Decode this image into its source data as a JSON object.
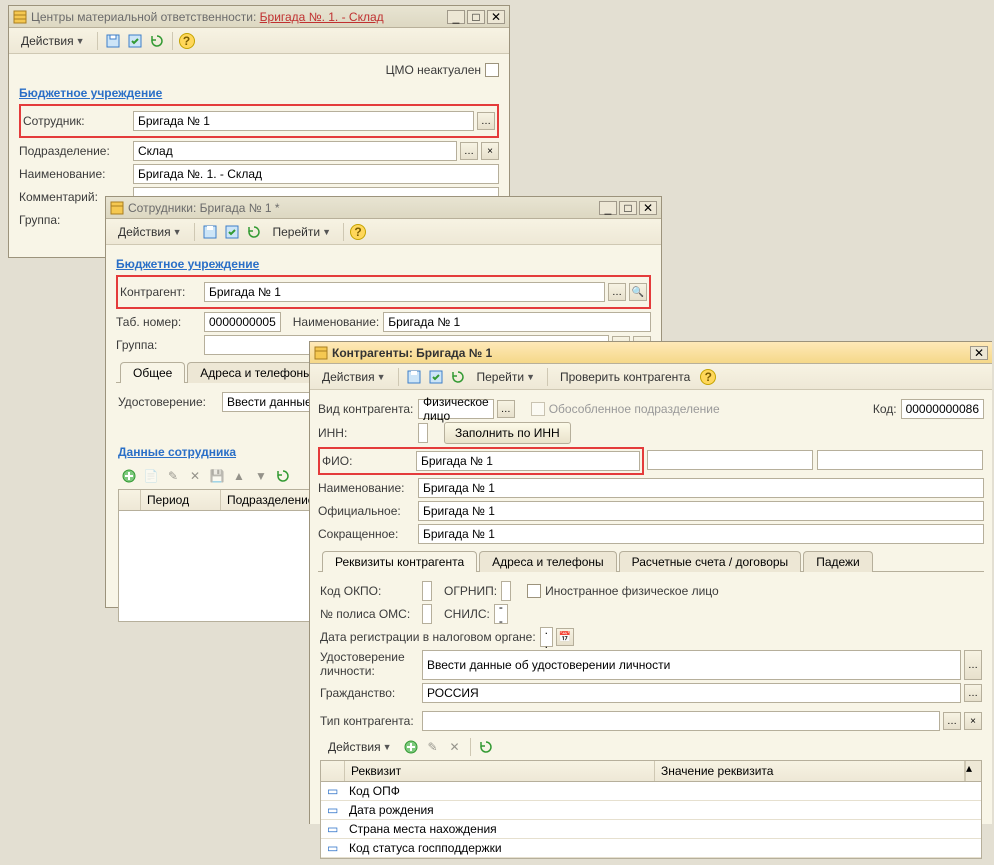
{
  "toolbar": {
    "actions": "Действия",
    "goto": "Перейти",
    "check": "Проверить контрагента"
  },
  "win1": {
    "title_prefix": "Центры материальной ответственности: ",
    "title_red": "Бригада №. 1. - Склад",
    "not_actual": "ЦМО неактуален",
    "section": "Бюджетное учреждение",
    "fields": {
      "employee_label": "Сотрудник:",
      "employee_value": "Бригада № 1",
      "dept_label": "Подразделение:",
      "dept_value": "Склад",
      "name_label": "Наименование:",
      "name_value": "Бригада №. 1. - Склад",
      "comment_label": "Комментарий:",
      "comment_value": "",
      "group_label": "Группа:",
      "group_value": ""
    }
  },
  "win2": {
    "title": "Сотрудники: Бригада № 1 *",
    "section": "Бюджетное учреждение",
    "fields": {
      "counterparty_label": "Контрагент:",
      "counterparty_value": "Бригада № 1",
      "tabnum_label": "Таб. номер:",
      "tabnum_value": "0000000005",
      "name_label": "Наименование:",
      "name_value": "Бригада № 1",
      "group_label": "Группа:",
      "group_value": ""
    },
    "tabs": {
      "general": "Общее",
      "addresses": "Адреса и телефоны"
    },
    "identity_label": "Удостоверение:",
    "identity_value": "Ввести данные об",
    "section2": "Данные сотрудника",
    "table_headers": [
      "Период",
      "Подразделение"
    ]
  },
  "win3": {
    "title": "Контрагенты: Бригада № 1",
    "fields": {
      "kind_label": "Вид контрагента:",
      "kind_value": "Физическое лицо",
      "detached_label": "Обособленное подразделение",
      "code_label": "Код:",
      "code_value": "00000000086",
      "inn_label": "ИНН:",
      "inn_value": "",
      "fill_inn": "Заполнить по ИНН",
      "fio_label": "ФИО:",
      "fio_value": "Бригада № 1",
      "name_label": "Наименование:",
      "name_value": "Бригада № 1",
      "official_label": "Официальное:",
      "official_value": "Бригада № 1",
      "short_label": "Сокращенное:",
      "short_value": "Бригада № 1"
    },
    "tabs": {
      "req": "Реквизиты контрагента",
      "addr": "Адреса и телефоны",
      "acc": "Расчетные счета / договоры",
      "cases": "Падежи"
    },
    "details": {
      "okpo_label": "Код ОКПО:",
      "okpo_value": "",
      "ogrnip_label": "ОГРНИП:",
      "ogrnip_value": "",
      "foreign_label": "Иностранное физическое лицо",
      "oms_label": "№ полиса ОМС:",
      "oms_value": "",
      "snils_label": "СНИЛС:",
      "snils_value": "  -   -",
      "regdate_label": "Дата регистрации в налоговом органе:",
      "regdate_value": "  .  .    ",
      "identity_label": "Удостоверение личности:",
      "identity_value": "Ввести данные об удостоверении личности",
      "citizenship_label": "Гражданство:",
      "citizenship_value": "РОССИЯ",
      "ctype_label": "Тип контрагента:",
      "ctype_value": ""
    },
    "table": {
      "headers": [
        "Реквизит",
        "Значение реквизита"
      ],
      "rows": [
        "Код ОПФ",
        "Дата рождения",
        "Страна места нахождения",
        "Код статуса госпподдержки"
      ]
    }
  },
  "icons": {
    "ellipsis": "…",
    "search": "🔍",
    "clear": "×",
    "cal": "📅"
  }
}
